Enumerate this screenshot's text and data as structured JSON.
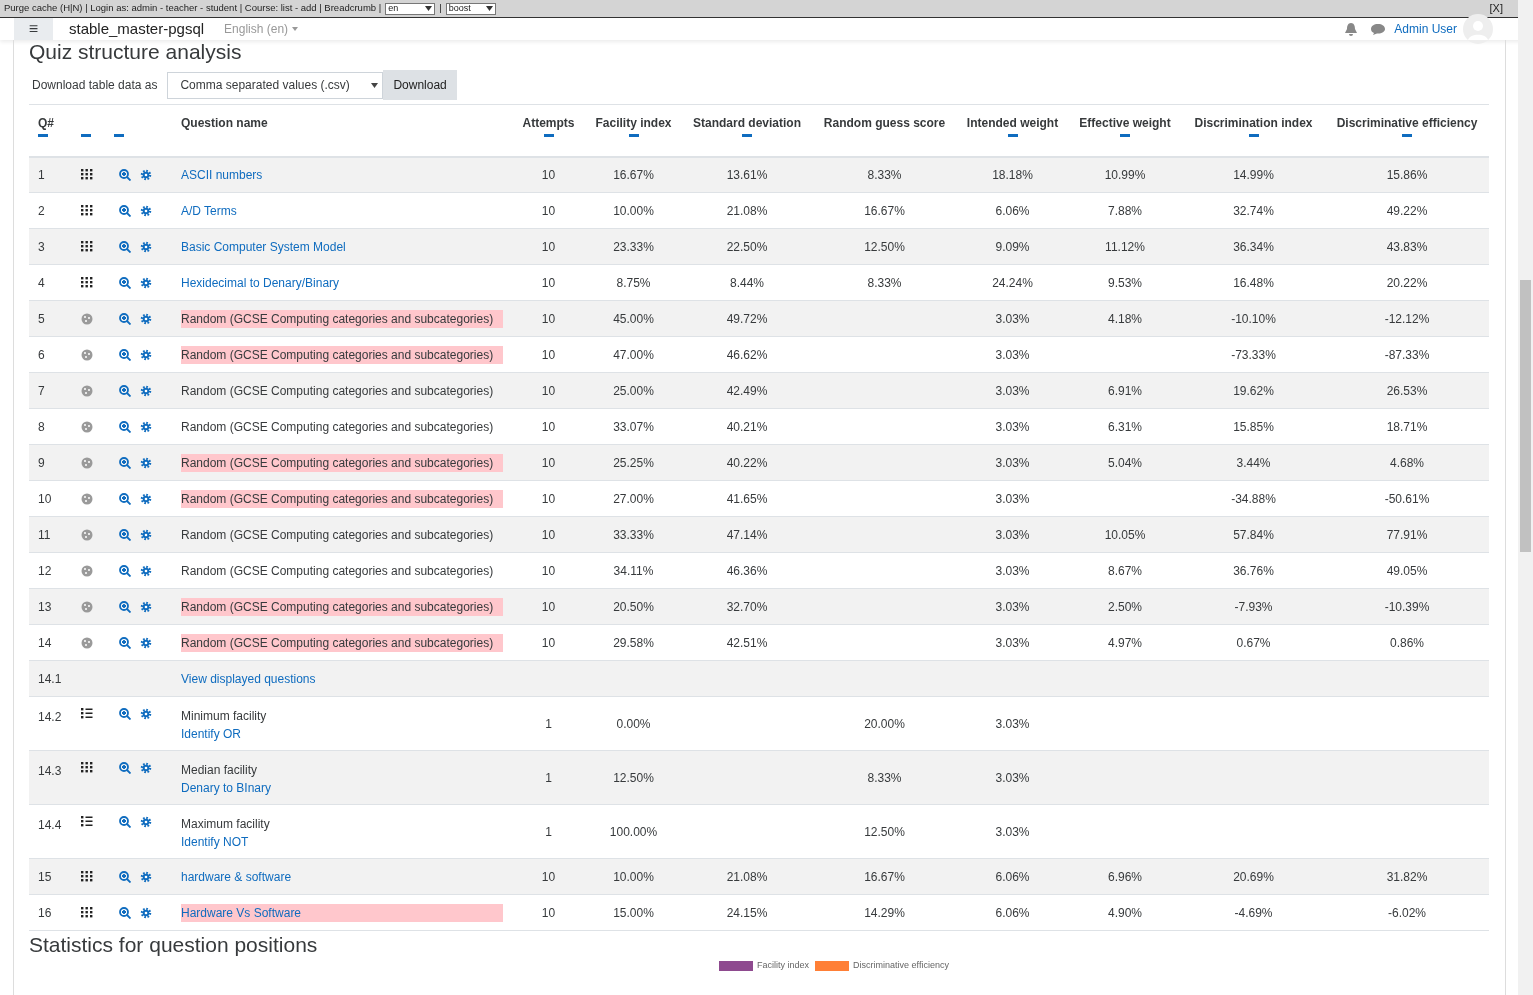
{
  "debug_bar": {
    "text": "Purge cache (H|N) | Login as: admin - teacher - student | Course: list - add | Breadcrumb |",
    "selects": [
      "en",
      "boost"
    ],
    "separator": "|",
    "close": "[X]"
  },
  "navbar": {
    "menu": "≡",
    "site": "stable_master-pgsql",
    "language": "English (en)",
    "user": "Admin User"
  },
  "title": "Quiz structure analysis",
  "download": {
    "label": "Download table data as",
    "format": "Comma separated values (.csv)",
    "button": "Download"
  },
  "columns": [
    {
      "label": "Q#",
      "sortable": true
    },
    {
      "sortable": true
    },
    {
      "sortable": true
    },
    {
      "label": "Question name",
      "sortable": false
    },
    {
      "label": "Attempts",
      "sortable": true
    },
    {
      "label": "Facility index",
      "sortable": true
    },
    {
      "label": "Standard deviation",
      "sortable": true
    },
    {
      "label": "Random guess score",
      "sortable": false
    },
    {
      "label": "Intended weight",
      "sortable": true
    },
    {
      "label": "Effective weight",
      "sortable": true
    },
    {
      "label": "Discrimination index",
      "sortable": true
    },
    {
      "label": "Discriminative efficiency",
      "sortable": true
    }
  ],
  "rows": [
    {
      "q": "1",
      "kind": "grid",
      "name": "ASCII numbers",
      "link": true,
      "flagged": false,
      "cells": {
        "attempts": "10",
        "facility": "16.67%",
        "sd": "13.61%",
        "guess": "8.33%",
        "intended": "18.18%",
        "effective": "10.99%",
        "discrimination": "14.99%",
        "efficiency": "15.86%"
      }
    },
    {
      "q": "2",
      "kind": "grid",
      "name": "A/D Terms",
      "link": true,
      "flagged": false,
      "cells": {
        "attempts": "10",
        "facility": "10.00%",
        "sd": "21.08%",
        "guess": "16.67%",
        "intended": "6.06%",
        "effective": "7.88%",
        "discrimination": "32.74%",
        "efficiency": "49.22%"
      }
    },
    {
      "q": "3",
      "kind": "grid",
      "name": "Basic Computer System Model",
      "link": true,
      "flagged": false,
      "cells": {
        "attempts": "10",
        "facility": "23.33%",
        "sd": "22.50%",
        "guess": "12.50%",
        "intended": "9.09%",
        "effective": "11.12%",
        "discrimination": "36.34%",
        "efficiency": "43.83%"
      }
    },
    {
      "q": "4",
      "kind": "grid",
      "name": "Hexidecimal to Denary/Binary",
      "link": true,
      "flagged": false,
      "cells": {
        "attempts": "10",
        "facility": "8.75%",
        "sd": "8.44%",
        "guess": "8.33%",
        "intended": "24.24%",
        "effective": "9.53%",
        "discrimination": "16.48%",
        "efficiency": "20.22%"
      }
    },
    {
      "q": "5",
      "kind": "random",
      "name": "Random (GCSE Computing categories and subcategories)",
      "link": false,
      "flagged": true,
      "cells": {
        "attempts": "10",
        "facility": "45.00%",
        "sd": "49.72%",
        "intended": "3.03%",
        "effective": "4.18%",
        "discrimination": "-10.10%",
        "efficiency": "-12.12%"
      }
    },
    {
      "q": "6",
      "kind": "random",
      "name": "Random (GCSE Computing categories and subcategories)",
      "link": false,
      "flagged": true,
      "cells": {
        "attempts": "10",
        "facility": "47.00%",
        "sd": "46.62%",
        "intended": "3.03%",
        "discrimination": "-73.33%",
        "efficiency": "-87.33%"
      }
    },
    {
      "q": "7",
      "kind": "random",
      "name": "Random (GCSE Computing categories and subcategories)",
      "link": false,
      "flagged": false,
      "cells": {
        "attempts": "10",
        "facility": "25.00%",
        "sd": "42.49%",
        "intended": "3.03%",
        "effective": "6.91%",
        "discrimination": "19.62%",
        "efficiency": "26.53%"
      }
    },
    {
      "q": "8",
      "kind": "random",
      "name": "Random (GCSE Computing categories and subcategories)",
      "link": false,
      "flagged": false,
      "cells": {
        "attempts": "10",
        "facility": "33.07%",
        "sd": "40.21%",
        "intended": "3.03%",
        "effective": "6.31%",
        "discrimination": "15.85%",
        "efficiency": "18.71%"
      }
    },
    {
      "q": "9",
      "kind": "random",
      "name": "Random (GCSE Computing categories and subcategories)",
      "link": false,
      "flagged": true,
      "cells": {
        "attempts": "10",
        "facility": "25.25%",
        "sd": "40.22%",
        "intended": "3.03%",
        "effective": "5.04%",
        "discrimination": "3.44%",
        "efficiency": "4.68%"
      }
    },
    {
      "q": "10",
      "kind": "random",
      "name": "Random (GCSE Computing categories and subcategories)",
      "link": false,
      "flagged": true,
      "cells": {
        "attempts": "10",
        "facility": "27.00%",
        "sd": "41.65%",
        "intended": "3.03%",
        "discrimination": "-34.88%",
        "efficiency": "-50.61%"
      }
    },
    {
      "q": "11",
      "kind": "random",
      "name": "Random (GCSE Computing categories and subcategories)",
      "link": false,
      "flagged": false,
      "cells": {
        "attempts": "10",
        "facility": "33.33%",
        "sd": "47.14%",
        "intended": "3.03%",
        "effective": "10.05%",
        "discrimination": "57.84%",
        "efficiency": "77.91%"
      }
    },
    {
      "q": "12",
      "kind": "random",
      "name": "Random (GCSE Computing categories and subcategories)",
      "link": false,
      "flagged": false,
      "cells": {
        "attempts": "10",
        "facility": "34.11%",
        "sd": "46.36%",
        "intended": "3.03%",
        "effective": "8.67%",
        "discrimination": "36.76%",
        "efficiency": "49.05%"
      }
    },
    {
      "q": "13",
      "kind": "random",
      "name": "Random (GCSE Computing categories and subcategories)",
      "link": false,
      "flagged": true,
      "cells": {
        "attempts": "10",
        "facility": "20.50%",
        "sd": "32.70%",
        "intended": "3.03%",
        "effective": "2.50%",
        "discrimination": "-7.93%",
        "efficiency": "-10.39%"
      }
    },
    {
      "q": "14",
      "kind": "random",
      "name": "Random (GCSE Computing categories and subcategories)",
      "link": false,
      "flagged": true,
      "cells": {
        "attempts": "10",
        "facility": "29.58%",
        "sd": "42.51%",
        "intended": "3.03%",
        "effective": "4.97%",
        "discrimination": "0.67%",
        "efficiency": "0.86%"
      }
    },
    {
      "q": "14.1",
      "kind": "none",
      "name": "View displayed questions",
      "link": true,
      "flagged": false
    },
    {
      "q": "14.2",
      "kind": "list",
      "label": "Minimum facility",
      "name": "Identify OR",
      "link": true,
      "flagged": false,
      "cells": {
        "attempts": "1",
        "facility": "0.00%",
        "guess": "20.00%",
        "intended": "3.03%"
      }
    },
    {
      "q": "14.3",
      "kind": "grid",
      "label": "Median facility",
      "name": "Denary to BInary",
      "link": true,
      "flagged": false,
      "cells": {
        "attempts": "1",
        "facility": "12.50%",
        "guess": "8.33%",
        "intended": "3.03%"
      }
    },
    {
      "q": "14.4",
      "kind": "list",
      "label": "Maximum facility",
      "name": "Identify NOT",
      "link": true,
      "flagged": false,
      "cells": {
        "attempts": "1",
        "facility": "100.00%",
        "guess": "12.50%",
        "intended": "3.03%"
      }
    },
    {
      "q": "15",
      "kind": "grid",
      "name": "hardware & software",
      "link": true,
      "flagged": false,
      "cells": {
        "attempts": "10",
        "facility": "10.00%",
        "sd": "21.08%",
        "guess": "16.67%",
        "intended": "6.06%",
        "effective": "6.96%",
        "discrimination": "20.69%",
        "efficiency": "31.82%"
      }
    },
    {
      "q": "16",
      "kind": "grid",
      "name": "Hardware Vs Software",
      "link": true,
      "flagged": true,
      "cells": {
        "attempts": "10",
        "facility": "15.00%",
        "sd": "24.15%",
        "guess": "14.29%",
        "intended": "6.06%",
        "effective": "4.90%",
        "discrimination": "-4.69%",
        "efficiency": "-6.02%"
      }
    }
  ],
  "section_title": "Statistics for question positions",
  "legend": [
    {
      "label": "Facility index",
      "color": "#8e4a8f"
    },
    {
      "label": "Discriminative efficiency",
      "color": "#ff7f36"
    }
  ]
}
